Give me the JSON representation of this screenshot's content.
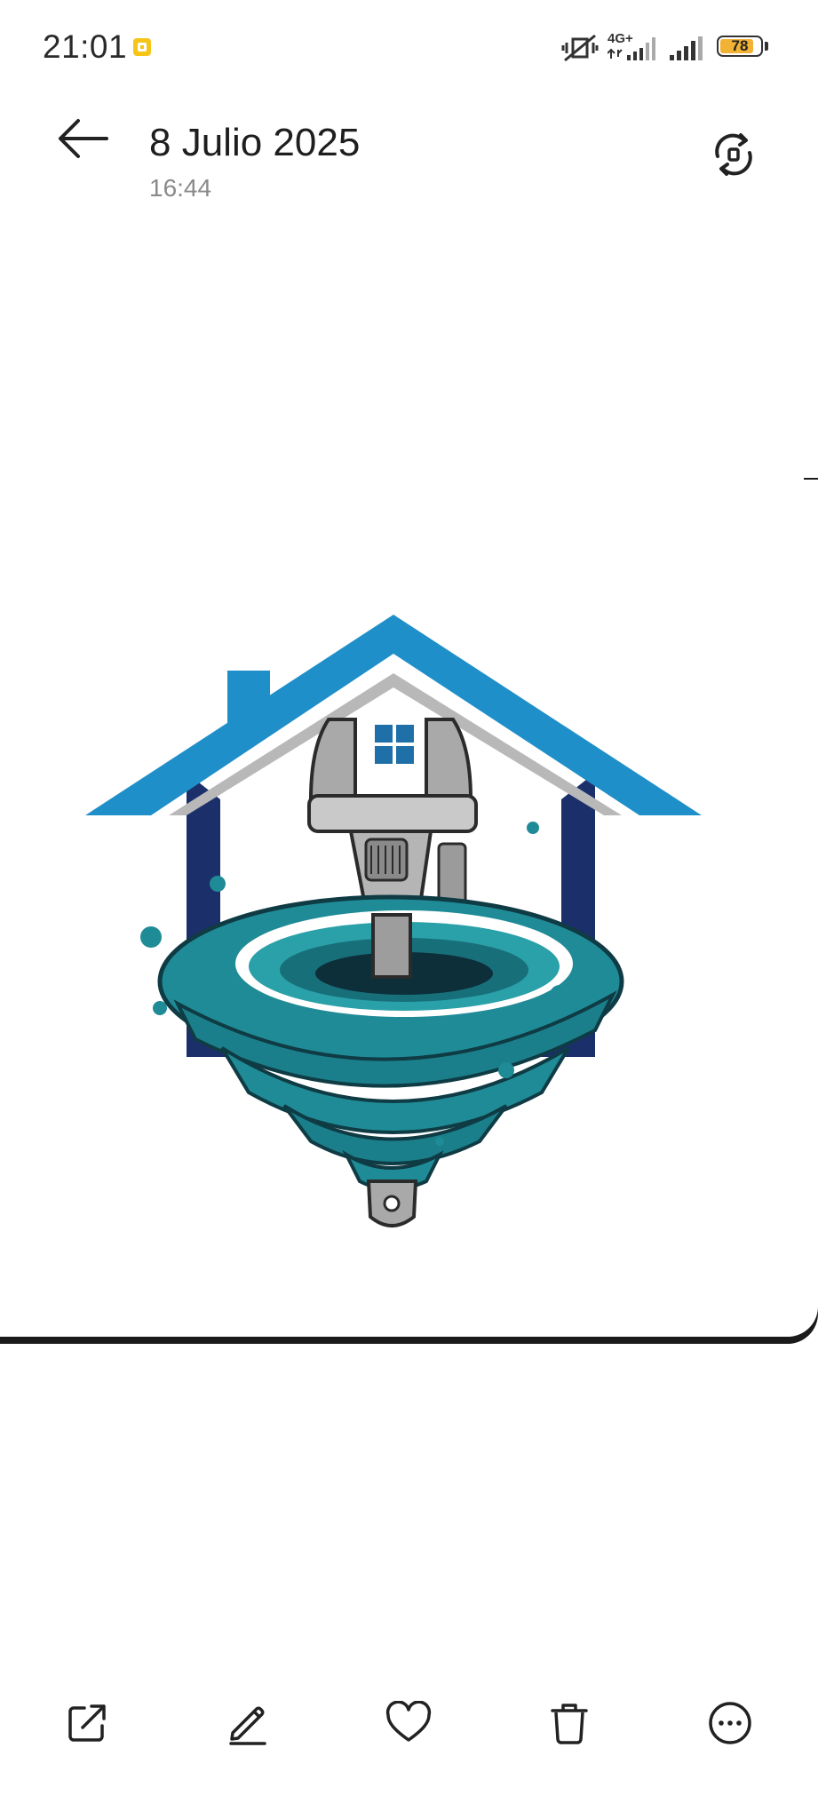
{
  "status_bar": {
    "time": "21:01",
    "network": "4G+",
    "battery_level": 78,
    "battery_text": "78",
    "icons": [
      "notification-icon",
      "mute-vibrate-icon",
      "signal-4g-icon",
      "signal-icon",
      "battery-icon"
    ]
  },
  "header": {
    "title": "8 Julio 2025",
    "subtitle": "16:44",
    "back_icon": "arrow-left-icon",
    "rotate_icon": "rotate-icon"
  },
  "photo": {
    "description_icon": "plumbing-logo-image"
  },
  "toolbar": {
    "items": [
      {
        "icon": "share-icon"
      },
      {
        "icon": "edit-icon"
      },
      {
        "icon": "favorite-icon"
      },
      {
        "icon": "delete-icon"
      },
      {
        "icon": "more-icon"
      }
    ]
  },
  "colors": {
    "roof_blue": "#1f8fc9",
    "house_navy": "#1b2f6b",
    "water_teal": "#1f8b96",
    "battery": "#f2b233"
  }
}
